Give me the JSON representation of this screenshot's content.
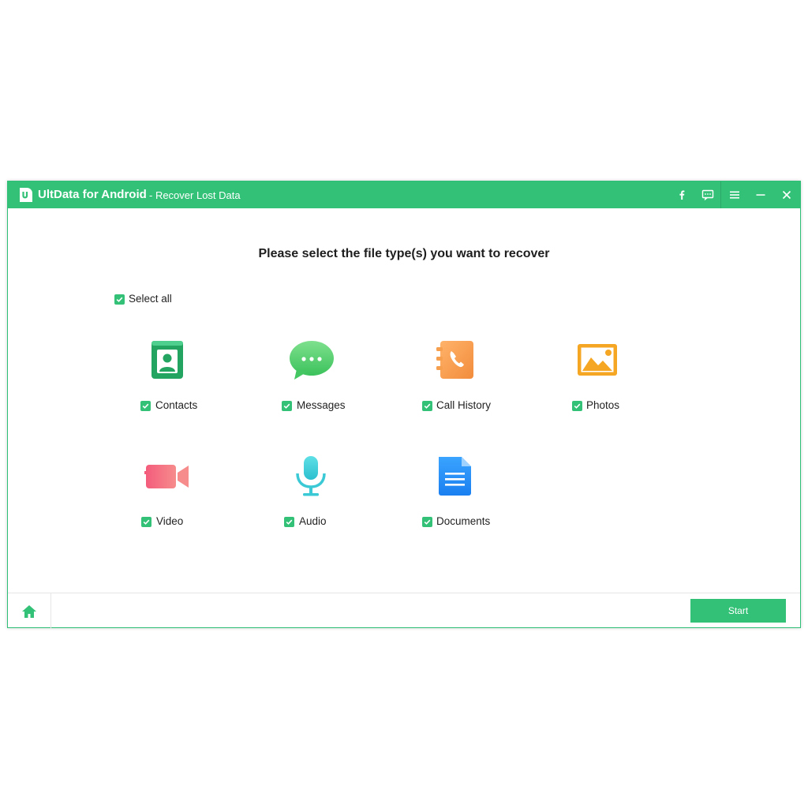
{
  "window": {
    "app_name": "UltData for Android",
    "subtitle": "- Recover Lost Data",
    "accent_color": "#33c177",
    "title_icons": [
      "facebook-icon",
      "feedback-icon",
      "menu-icon",
      "minimize-icon",
      "close-icon"
    ]
  },
  "main": {
    "heading": "Please select the file type(s) you want to recover",
    "select_all": {
      "label": "Select all",
      "checked": true
    },
    "items": [
      {
        "label": "Contacts",
        "icon": "contacts-icon",
        "checked": true
      },
      {
        "label": "Messages",
        "icon": "messages-icon",
        "checked": true
      },
      {
        "label": "Call History",
        "icon": "call-history-icon",
        "checked": true
      },
      {
        "label": "Photos",
        "icon": "photos-icon",
        "checked": true
      },
      {
        "label": "Video",
        "icon": "video-icon",
        "checked": true
      },
      {
        "label": "Audio",
        "icon": "audio-icon",
        "checked": true
      },
      {
        "label": "Documents",
        "icon": "documents-icon",
        "checked": true
      }
    ]
  },
  "footer": {
    "home_icon": "home-icon",
    "start_label": "Start"
  }
}
